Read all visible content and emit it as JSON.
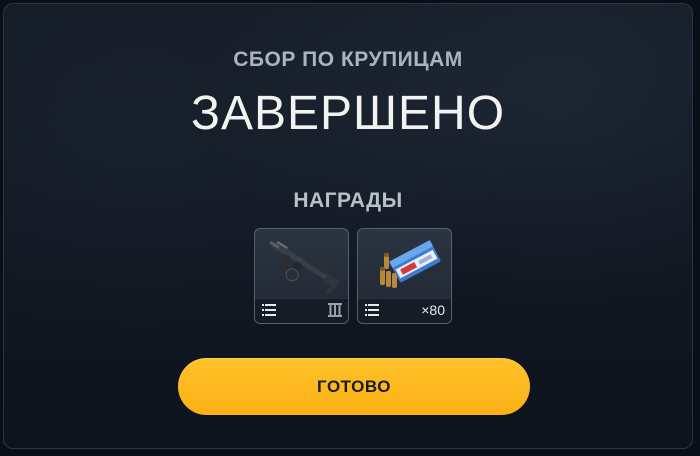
{
  "dialog": {
    "subtitle": "СБОР ПО КРУПИЦАМ",
    "title": "ЗАВЕРШЕНО",
    "rewards_label": "НАГРАДЫ"
  },
  "rewards": [
    {
      "item": "assault-rifle",
      "icon": "rifle-icon",
      "tier_icon": "tier-iii-icon",
      "tier": "III"
    },
    {
      "item": "ammo-box",
      "icon": "ammo-box-icon",
      "quantity": "×80"
    }
  ],
  "actions": {
    "done_label": "ГОТОВО"
  },
  "colors": {
    "accent": "#fbb015",
    "background": "#111823",
    "card_border": "#566170"
  }
}
